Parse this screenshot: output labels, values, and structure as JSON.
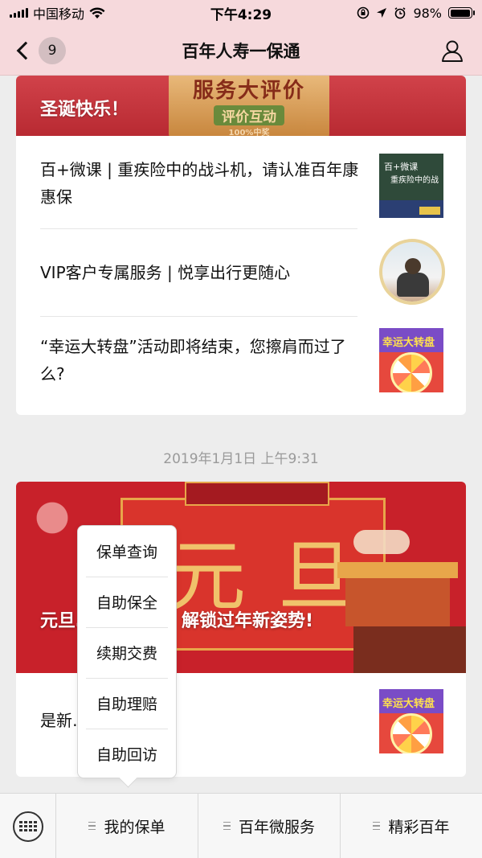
{
  "status_bar": {
    "carrier": "中国移动",
    "time": "下午4:29",
    "battery": "98%",
    "battery_level": 0.98
  },
  "nav": {
    "back_count": "9",
    "title": "百年人寿一保通"
  },
  "card1": {
    "banner": {
      "title": "圣诞快乐！",
      "deco_line1": "服务大评价",
      "deco_line2": "评价互动",
      "deco_line3": "100%中奖"
    },
    "items": [
      {
        "text": "百+微课 | 重疾险中的战斗机，请认准百年康惠保",
        "thumb_line1": "百+微课",
        "thumb_line2": "重疾险中的战"
      },
      {
        "text": "VIP客户专属服务 | 悦享出行更随心"
      },
      {
        "text": "“幸运大转盘”活动即将结束，您擦肩而过了么?",
        "thumb_line1": "幸运大转盘"
      }
    ]
  },
  "timestamp": "2019年1月1日 上午9:31",
  "card2": {
    "banner": {
      "big_text": "元旦",
      "title": "元旦…式迎新年，解锁过年新姿势!"
    },
    "items": [
      {
        "text": "是新…是新年礼物?",
        "thumb_line1": "幸运大转盘"
      }
    ]
  },
  "popup_menu": {
    "items": [
      "保单查询",
      "自助保全",
      "续期交费",
      "自助理赔",
      "自助回访"
    ]
  },
  "bottom_menu": {
    "tabs": [
      "我的保单",
      "百年微服务",
      "精彩百年"
    ]
  }
}
